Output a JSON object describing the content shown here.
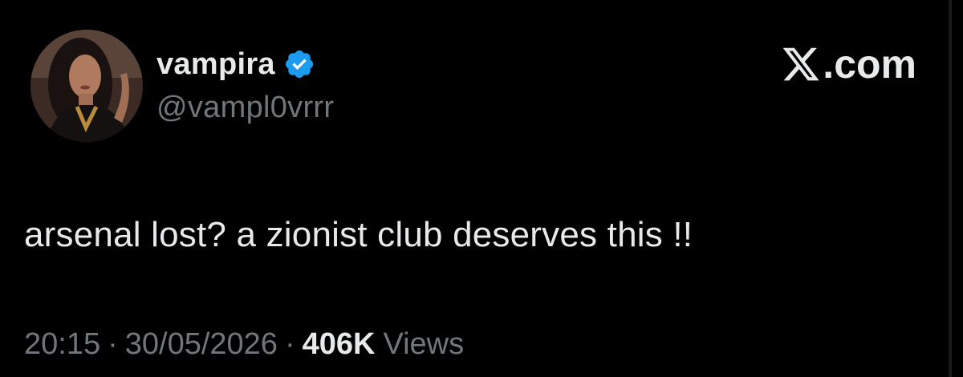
{
  "tweet": {
    "author": {
      "display_name": "vampira",
      "handle": "@vampl0vrrr",
      "verified": true,
      "verified_color": "#1d9bf0"
    },
    "brand": {
      "label": ".com",
      "icon": "x-logo-icon"
    },
    "text": "arsenal lost? a zionist club deserves this !!",
    "meta": {
      "time": "20:15",
      "separator": "·",
      "date": "30/05/2026",
      "views_count": "406K",
      "views_label": "Views"
    }
  },
  "colors": {
    "background": "#000000",
    "primary_text": "#e7e9ea",
    "secondary_text": "#71767b",
    "accent": "#1d9bf0"
  }
}
